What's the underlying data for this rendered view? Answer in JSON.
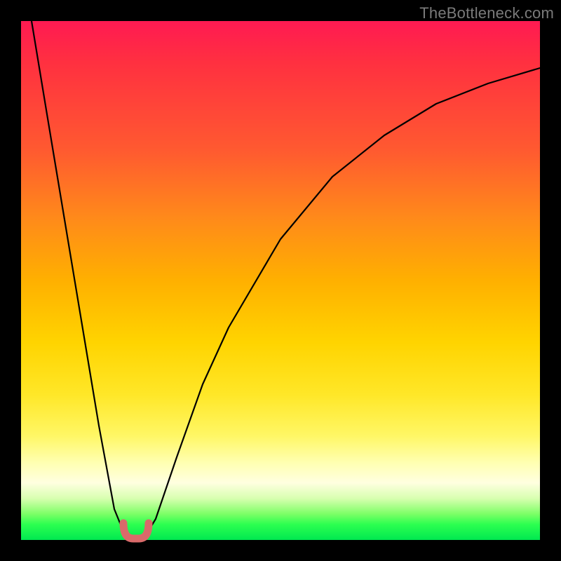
{
  "watermark": "TheBottleneck.com",
  "chart_data": {
    "type": "line",
    "title": "",
    "xlabel": "",
    "ylabel": "",
    "xlim": [
      0,
      100
    ],
    "ylim": [
      0,
      100
    ],
    "grid": false,
    "legend": false,
    "series": [
      {
        "name": "bottleneck-curve",
        "x": [
          2,
          5,
          10,
          15,
          18,
          20,
          21,
          22,
          23,
          24,
          26,
          30,
          35,
          40,
          50,
          60,
          70,
          80,
          90,
          100
        ],
        "y": [
          100,
          82,
          52,
          22,
          6,
          1,
          0,
          0,
          0,
          1,
          4,
          16,
          30,
          41,
          58,
          70,
          78,
          84,
          88,
          91
        ]
      }
    ],
    "annotations": [
      {
        "name": "valley-marker",
        "shape": "u-stroke",
        "color": "#d96a6a",
        "x_range": [
          20,
          24
        ],
        "y_range": [
          0,
          3
        ]
      }
    ],
    "background_gradient": {
      "direction": "vertical",
      "stops": [
        {
          "pos": 0.0,
          "color": "#ff1a52"
        },
        {
          "pos": 0.5,
          "color": "#ffb000"
        },
        {
          "pos": 0.85,
          "color": "#ffffb0"
        },
        {
          "pos": 1.0,
          "color": "#00e850"
        }
      ]
    }
  }
}
